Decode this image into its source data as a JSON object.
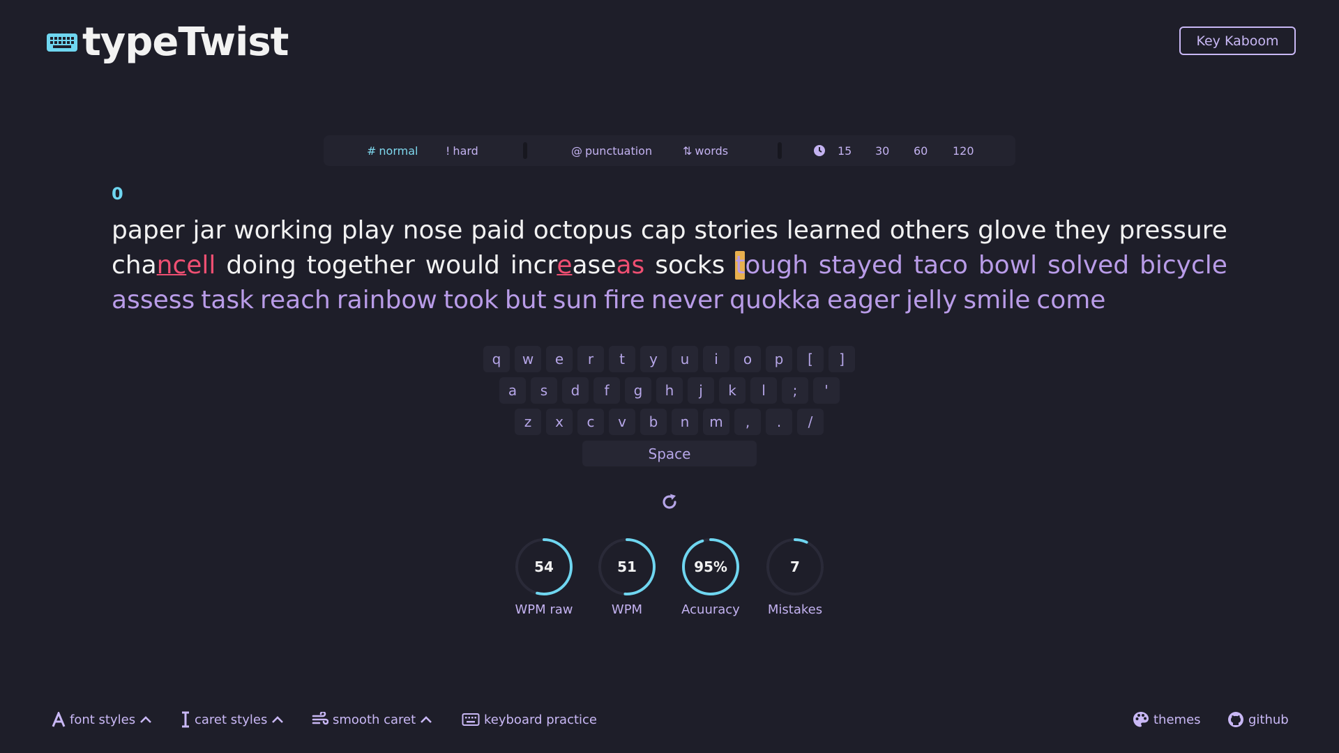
{
  "app": {
    "title": "typeTwist",
    "top_button": "Key Kaboom"
  },
  "modebar": {
    "difficulty": [
      {
        "symbol": "#",
        "label": "normal",
        "active": true
      },
      {
        "symbol": "!",
        "label": "hard",
        "active": false
      }
    ],
    "options": [
      {
        "icon": "at-icon",
        "symbol": "@",
        "label": "punctuation"
      },
      {
        "icon": "sort-icon",
        "symbol": "⇅",
        "label": "words"
      }
    ],
    "time_icon": "clock-icon",
    "times": [
      "15",
      "30",
      "60",
      "120"
    ]
  },
  "counter": "0",
  "words": {
    "line1": [
      "paper",
      "jar",
      "working",
      "play",
      "nose",
      "paid",
      "octopus",
      "cap",
      "stories",
      "learned",
      "others",
      "glove",
      "they",
      "pressure"
    ],
    "line2_typed": {
      "w1_a": "cha",
      "w1_b": "nc",
      "w1_c": "ell",
      "w2": "doing",
      "w3": "together",
      "w4": "would",
      "w5_a": "incr",
      "w5_b": "e",
      "w5_c": "ase",
      "w5_d": "as",
      "w6": "socks",
      "w7_caret": "t",
      "w7_rest": "ough"
    },
    "line2_pending": [
      "stayed",
      "taco",
      "bowl",
      "solved",
      "bicycle"
    ],
    "line3": [
      "assess",
      "task",
      "reach",
      "rainbow",
      "took",
      "but",
      "sun",
      "fire",
      "never",
      "quokka",
      "eager",
      "jelly",
      "smile",
      "come"
    ]
  },
  "keyboard": {
    "row1": [
      "q",
      "w",
      "e",
      "r",
      "t",
      "y",
      "u",
      "i",
      "o",
      "p",
      "[",
      "]"
    ],
    "row2": [
      "a",
      "s",
      "d",
      "f",
      "g",
      "h",
      "j",
      "k",
      "l",
      ";",
      "'"
    ],
    "row3": [
      "z",
      "x",
      "c",
      "v",
      "b",
      "n",
      "m",
      ",",
      ".",
      "/"
    ],
    "space": "Space"
  },
  "stats": [
    {
      "value": "54",
      "label": "WPM raw",
      "fraction": 0.54
    },
    {
      "value": "51",
      "label": "WPM",
      "fraction": 0.51
    },
    {
      "value": "95%",
      "label": "Acuuracy",
      "fraction": 0.95
    },
    {
      "value": "7",
      "label": "Mistakes",
      "fraction": 0.07
    }
  ],
  "footer": {
    "font_styles": "font styles",
    "caret_styles": "caret styles",
    "smooth_caret": "smooth caret",
    "keyboard_practice": "keyboard practice",
    "themes": "themes",
    "github": "github"
  },
  "colors": {
    "background": "#1e1e29",
    "accent": "#6fd6f0",
    "pending_text": "#b99ce8",
    "error": "#ef4f72",
    "caret": "#e8b04e"
  }
}
